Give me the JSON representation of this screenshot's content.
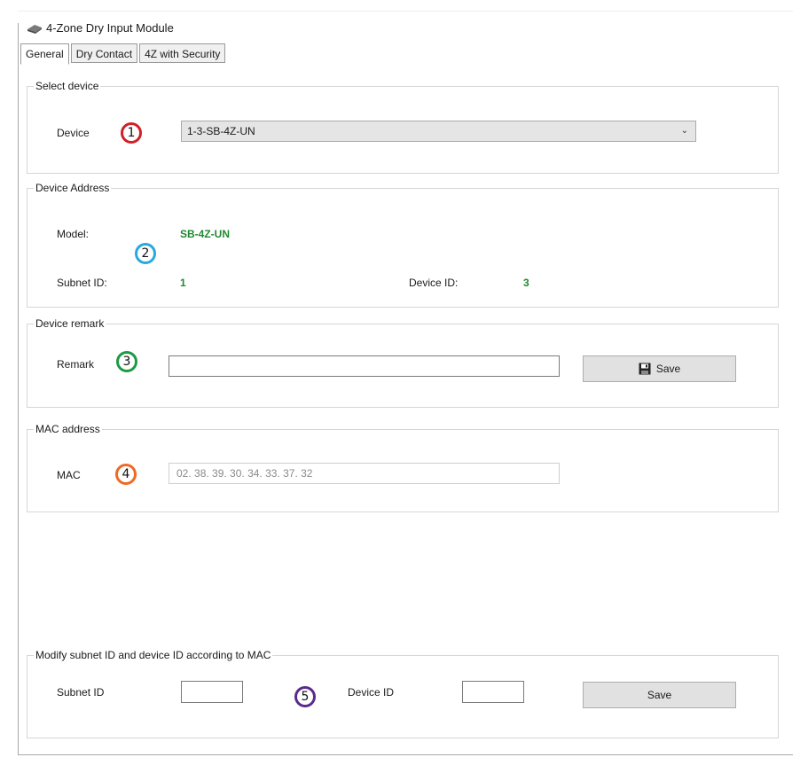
{
  "window": {
    "title": "4-Zone Dry Input Module"
  },
  "tabs": [
    {
      "label": "General"
    },
    {
      "label": "Dry Contact"
    },
    {
      "label": "4Z with Security"
    }
  ],
  "select_device": {
    "legend": "Select device",
    "device_label": "Device",
    "device_value": "1-3-SB-4Z-UN"
  },
  "device_address": {
    "legend": "Device Address",
    "model_label": "Model:",
    "model_value": "SB-4Z-UN",
    "subnet_label": "Subnet ID:",
    "subnet_value": "1",
    "device_id_label": "Device ID:",
    "device_id_value": "3"
  },
  "device_remark": {
    "legend": "Device remark",
    "remark_label": "Remark",
    "remark_value": "",
    "save_label": "Save"
  },
  "mac_address": {
    "legend": "MAC address",
    "mac_label": "MAC",
    "mac_value": "02. 38. 39. 30. 34. 33. 37. 32"
  },
  "modify": {
    "legend": "Modify subnet ID and device ID according to MAC",
    "subnet_label": "Subnet ID",
    "subnet_value": "",
    "device_id_label": "Device ID",
    "device_id_value": "",
    "save_label": "Save"
  },
  "badges": [
    "1",
    "2",
    "3",
    "4",
    "5"
  ],
  "colors": {
    "accent_green": "#1f8a2e",
    "badge_red": "#d0202a",
    "badge_blue": "#29a8e0",
    "badge_green": "#1d9a43",
    "badge_orange": "#ee6a25",
    "badge_purple": "#5b2a8c"
  },
  "icons": {
    "title": "module-icon",
    "save": "floppy-disk-icon",
    "dropdown": "chevron-down-icon"
  }
}
